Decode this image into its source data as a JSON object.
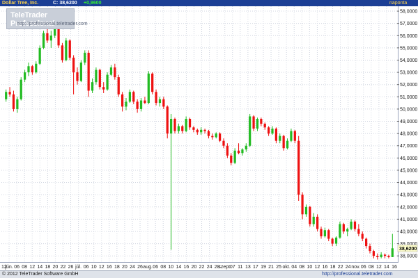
{
  "header": {
    "ticker": "Dollar Tree, Inc.",
    "close_label": "C: 38,6200",
    "change": "+0,9600",
    "period": "naponta"
  },
  "watermark": {
    "brand": "TeleTrader Professional",
    "url": "http://professional.teletrader.com"
  },
  "footer": {
    "copyright": "© 2012 TeleTrader Software GmbH",
    "url": "http://professional.teletrader.com"
  },
  "colors": {
    "up": "#22bb22",
    "down": "#ee1111",
    "header_bg": "#1c3f95",
    "grid": "#d0d5e0",
    "change_positive": "#33ee33"
  },
  "chart_data": {
    "type": "candlestick",
    "title": "Dollar Tree, Inc.",
    "y_ticks": [
      "38,0000",
      "39,0000",
      "40,0000",
      "41,0000",
      "42,0000",
      "43,0000",
      "44,0000",
      "45,0000",
      "46,0000",
      "47,0000",
      "48,0000",
      "49,0000",
      "50,0000",
      "51,0000",
      "52,0000",
      "53,0000",
      "54,0000",
      "55,0000",
      "56,0000",
      "57,0000",
      "58,0000"
    ],
    "y_range": [
      37.5,
      58.4
    ],
    "last_price_label": "38,6200",
    "last_price": 38.62,
    "x_ticks": [
      "12",
      "jún.",
      "06",
      "08",
      "12",
      "14",
      "18",
      "20",
      "22",
      "26",
      "júl.",
      "06",
      "10",
      "12",
      "16",
      "18",
      "20",
      "24",
      "26",
      "aug.",
      "06",
      "08",
      "10",
      "14",
      "16",
      "20",
      "22",
      "24",
      "28",
      "szept.",
      "07",
      "11",
      "13",
      "17",
      "19",
      "21",
      "25",
      "okt.",
      "04",
      "08",
      "10",
      "12",
      "16",
      "18",
      "22",
      "24",
      "nov.",
      "06",
      "08",
      "12",
      "14",
      "16"
    ],
    "ohlc": [
      [
        50.8,
        51.6,
        50.6,
        51.4
      ],
      [
        51.4,
        51.8,
        51.0,
        51.2
      ],
      [
        51.2,
        51.5,
        49.8,
        50.0
      ],
      [
        50.0,
        51.0,
        49.7,
        50.8
      ],
      [
        50.8,
        52.6,
        50.7,
        52.4
      ],
      [
        52.4,
        53.2,
        52.2,
        53.0
      ],
      [
        53.0,
        53.8,
        52.7,
        53.5
      ],
      [
        53.5,
        53.6,
        52.8,
        53.0
      ],
      [
        53.0,
        53.9,
        52.9,
        53.7
      ],
      [
        53.7,
        55.2,
        53.6,
        55.0
      ],
      [
        55.0,
        56.4,
        54.9,
        56.2
      ],
      [
        56.2,
        57.0,
        55.4,
        55.6
      ],
      [
        55.6,
        56.4,
        55.0,
        56.0
      ],
      [
        56.0,
        56.8,
        55.8,
        56.6
      ],
      [
        56.6,
        56.7,
        55.0,
        55.2
      ],
      [
        55.2,
        55.4,
        53.8,
        54.0
      ],
      [
        54.0,
        55.8,
        53.9,
        55.6
      ],
      [
        55.6,
        55.7,
        54.0,
        54.2
      ],
      [
        54.2,
        54.4,
        51.2,
        53.0
      ],
      [
        53.0,
        53.4,
        52.0,
        52.3
      ],
      [
        52.3,
        54.0,
        52.2,
        53.8
      ],
      [
        53.8,
        54.8,
        53.6,
        54.6
      ],
      [
        54.6,
        54.8,
        51.0,
        51.5
      ],
      [
        51.5,
        52.5,
        51.3,
        52.2
      ],
      [
        52.2,
        53.4,
        52.0,
        53.2
      ],
      [
        53.2,
        53.3,
        51.6,
        51.8
      ],
      [
        51.8,
        52.2,
        51.3,
        51.6
      ],
      [
        51.6,
        53.0,
        51.5,
        52.8
      ],
      [
        52.8,
        53.6,
        52.7,
        53.4
      ],
      [
        53.4,
        53.7,
        52.4,
        52.6
      ],
      [
        52.6,
        52.8,
        51.0,
        51.2
      ],
      [
        51.2,
        51.4,
        49.8,
        50.2
      ],
      [
        50.2,
        50.9,
        49.9,
        50.6
      ],
      [
        50.6,
        51.6,
        50.5,
        51.4
      ],
      [
        51.4,
        51.5,
        50.4,
        50.6
      ],
      [
        50.6,
        50.8,
        49.7,
        50.0
      ],
      [
        50.0,
        50.9,
        49.8,
        50.7
      ],
      [
        50.7,
        51.0,
        50.4,
        50.5
      ],
      [
        50.5,
        53.1,
        50.4,
        52.9
      ],
      [
        52.9,
        53.0,
        51.2,
        51.4
      ],
      [
        51.4,
        51.6,
        50.3,
        50.5
      ],
      [
        50.5,
        51.0,
        50.2,
        50.8
      ],
      [
        50.8,
        51.0,
        50.0,
        50.2
      ],
      [
        50.2,
        50.3,
        47.6,
        48.0
      ],
      [
        48.0,
        49.6,
        38.5,
        49.2
      ],
      [
        49.2,
        49.3,
        48.0,
        48.2
      ],
      [
        48.2,
        48.8,
        48.0,
        48.6
      ],
      [
        48.6,
        48.7,
        48.0,
        48.2
      ],
      [
        48.2,
        49.4,
        48.1,
        49.2
      ],
      [
        49.2,
        49.3,
        48.3,
        48.5
      ],
      [
        48.5,
        48.6,
        48.1,
        48.3
      ],
      [
        48.3,
        48.4,
        47.9,
        48.1
      ],
      [
        48.1,
        48.5,
        47.9,
        48.3
      ],
      [
        48.3,
        48.4,
        48.0,
        48.2
      ],
      [
        48.2,
        48.3,
        47.6,
        47.8
      ],
      [
        47.8,
        48.0,
        47.5,
        47.7
      ],
      [
        47.7,
        48.1,
        47.6,
        48.0
      ],
      [
        48.0,
        48.1,
        47.3,
        47.4
      ],
      [
        47.4,
        47.6,
        46.8,
        47.0
      ],
      [
        47.0,
        47.2,
        46.0,
        46.2
      ],
      [
        46.2,
        46.4,
        45.4,
        45.6
      ],
      [
        45.6,
        46.8,
        45.5,
        46.6
      ],
      [
        46.6,
        47.2,
        46.3,
        46.4
      ],
      [
        46.4,
        46.8,
        46.2,
        46.7
      ],
      [
        46.7,
        47.2,
        46.5,
        47.0
      ],
      [
        47.0,
        49.6,
        46.9,
        49.4
      ],
      [
        49.4,
        49.5,
        48.2,
        48.4
      ],
      [
        48.4,
        49.3,
        48.2,
        49.2
      ],
      [
        49.2,
        49.3,
        48.6,
        48.8
      ],
      [
        48.8,
        48.9,
        48.3,
        48.5
      ],
      [
        48.5,
        48.6,
        47.8,
        48.0
      ],
      [
        48.0,
        48.6,
        47.9,
        48.4
      ],
      [
        48.4,
        48.5,
        47.2,
        47.4
      ],
      [
        47.4,
        48.0,
        47.2,
        47.8
      ],
      [
        47.8,
        47.9,
        46.6,
        46.8
      ],
      [
        46.8,
        47.6,
        46.7,
        47.4
      ],
      [
        47.4,
        48.4,
        47.3,
        48.2
      ],
      [
        48.2,
        48.3,
        47.2,
        47.4
      ],
      [
        47.4,
        47.8,
        42.5,
        43.0
      ],
      [
        43.0,
        43.2,
        41.0,
        41.4
      ],
      [
        41.4,
        42.2,
        41.2,
        42.0
      ],
      [
        42.0,
        42.1,
        40.4,
        40.6
      ],
      [
        40.6,
        41.5,
        40.4,
        41.2
      ],
      [
        41.2,
        41.4,
        40.0,
        40.2
      ],
      [
        40.2,
        40.4,
        39.4,
        39.6
      ],
      [
        39.6,
        40.3,
        39.5,
        40.1
      ],
      [
        40.1,
        40.2,
        39.2,
        39.4
      ],
      [
        39.4,
        39.5,
        38.8,
        39.0
      ],
      [
        39.0,
        39.6,
        38.8,
        39.5
      ],
      [
        39.5,
        40.8,
        39.4,
        40.6
      ],
      [
        40.6,
        40.7,
        39.8,
        40.0
      ],
      [
        40.0,
        40.3,
        39.6,
        40.2
      ],
      [
        40.2,
        41.0,
        40.1,
        40.8
      ],
      [
        40.8,
        40.9,
        40.0,
        40.2
      ],
      [
        40.2,
        40.6,
        39.6,
        39.8
      ],
      [
        39.8,
        40.0,
        39.2,
        39.4
      ],
      [
        39.4,
        39.5,
        38.6,
        38.8
      ],
      [
        38.8,
        39.0,
        38.2,
        38.4
      ],
      [
        38.4,
        38.5,
        37.8,
        38.0
      ],
      [
        38.0,
        38.2,
        37.7,
        37.9
      ],
      [
        37.9,
        38.3,
        37.8,
        38.1
      ],
      [
        38.1,
        38.2,
        37.8,
        38.0
      ],
      [
        38.0,
        38.1,
        37.8,
        37.9
      ],
      [
        37.9,
        39.8,
        37.9,
        38.62
      ]
    ]
  }
}
